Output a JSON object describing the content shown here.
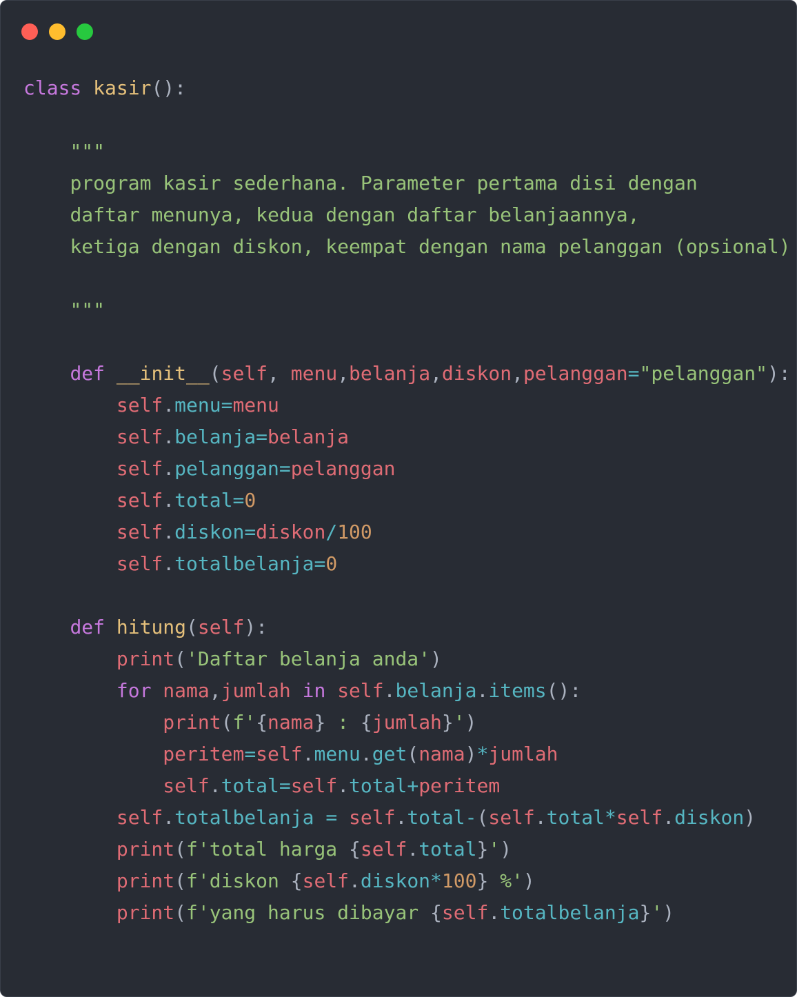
{
  "window": {
    "controls": [
      {
        "name": "close",
        "color": "#ff5f56"
      },
      {
        "name": "minimize",
        "color": "#ffbd2e"
      },
      {
        "name": "maximize",
        "color": "#27c93f"
      }
    ],
    "background": "#282c34"
  },
  "code_lines": [
    [
      [
        "kw",
        "class"
      ],
      [
        "pun",
        " "
      ],
      [
        "cls",
        "kasir"
      ],
      [
        "pun",
        "():"
      ]
    ],
    [],
    [
      [
        "pun",
        "    "
      ],
      [
        "doc",
        "\"\"\""
      ]
    ],
    [
      [
        "pun",
        "    "
      ],
      [
        "doc",
        "program kasir sederhana. Parameter pertama disi dengan"
      ]
    ],
    [
      [
        "pun",
        "    "
      ],
      [
        "doc",
        "daftar menunya, kedua dengan daftar belanjaannya,"
      ]
    ],
    [
      [
        "pun",
        "    "
      ],
      [
        "doc",
        "ketiga dengan diskon, keempat dengan nama pelanggan (opsional)"
      ]
    ],
    [],
    [
      [
        "pun",
        "    "
      ],
      [
        "doc",
        "\"\"\""
      ]
    ],
    [],
    [
      [
        "pun",
        "    "
      ],
      [
        "kw",
        "def"
      ],
      [
        "pun",
        " "
      ],
      [
        "fn",
        "__init__"
      ],
      [
        "pun",
        "("
      ],
      [
        "self",
        "self"
      ],
      [
        "pun",
        ", "
      ],
      [
        "var",
        "menu"
      ],
      [
        "pun",
        ","
      ],
      [
        "var",
        "belanja"
      ],
      [
        "pun",
        ","
      ],
      [
        "var",
        "diskon"
      ],
      [
        "pun",
        ","
      ],
      [
        "var",
        "pelanggan"
      ],
      [
        "op",
        "="
      ],
      [
        "str",
        "\"pelanggan\""
      ],
      [
        "pun",
        "):"
      ]
    ],
    [
      [
        "pun",
        "        "
      ],
      [
        "self",
        "self"
      ],
      [
        "pun",
        "."
      ],
      [
        "attr",
        "menu"
      ],
      [
        "op",
        "="
      ],
      [
        "var",
        "menu"
      ]
    ],
    [
      [
        "pun",
        "        "
      ],
      [
        "self",
        "self"
      ],
      [
        "pun",
        "."
      ],
      [
        "attr",
        "belanja"
      ],
      [
        "op",
        "="
      ],
      [
        "var",
        "belanja"
      ]
    ],
    [
      [
        "pun",
        "        "
      ],
      [
        "self",
        "self"
      ],
      [
        "pun",
        "."
      ],
      [
        "attr",
        "pelanggan"
      ],
      [
        "op",
        "="
      ],
      [
        "var",
        "pelanggan"
      ]
    ],
    [
      [
        "pun",
        "        "
      ],
      [
        "self",
        "self"
      ],
      [
        "pun",
        "."
      ],
      [
        "attr",
        "total"
      ],
      [
        "op",
        "="
      ],
      [
        "num",
        "0"
      ]
    ],
    [
      [
        "pun",
        "        "
      ],
      [
        "self",
        "self"
      ],
      [
        "pun",
        "."
      ],
      [
        "attr",
        "diskon"
      ],
      [
        "op",
        "="
      ],
      [
        "var",
        "diskon"
      ],
      [
        "op",
        "/"
      ],
      [
        "num",
        "100"
      ]
    ],
    [
      [
        "pun",
        "        "
      ],
      [
        "self",
        "self"
      ],
      [
        "pun",
        "."
      ],
      [
        "attr",
        "totalbelanja"
      ],
      [
        "op",
        "="
      ],
      [
        "num",
        "0"
      ]
    ],
    [],
    [
      [
        "pun",
        "    "
      ],
      [
        "kw",
        "def"
      ],
      [
        "pun",
        " "
      ],
      [
        "fn",
        "hitung"
      ],
      [
        "pun",
        "("
      ],
      [
        "self",
        "self"
      ],
      [
        "pun",
        "):"
      ]
    ],
    [
      [
        "pun",
        "        "
      ],
      [
        "builtin",
        "print"
      ],
      [
        "pun",
        "("
      ],
      [
        "str",
        "'Daftar belanja anda'"
      ],
      [
        "pun",
        ")"
      ]
    ],
    [
      [
        "pun",
        "        "
      ],
      [
        "kw",
        "for"
      ],
      [
        "pun",
        " "
      ],
      [
        "var",
        "nama"
      ],
      [
        "pun",
        ","
      ],
      [
        "var",
        "jumlah"
      ],
      [
        "pun",
        " "
      ],
      [
        "kw",
        "in"
      ],
      [
        "pun",
        " "
      ],
      [
        "self",
        "self"
      ],
      [
        "pun",
        "."
      ],
      [
        "attr",
        "belanja"
      ],
      [
        "pun",
        "."
      ],
      [
        "method",
        "items"
      ],
      [
        "pun",
        "():"
      ]
    ],
    [
      [
        "pun",
        "            "
      ],
      [
        "builtin",
        "print"
      ],
      [
        "pun",
        "("
      ],
      [
        "str",
        "f'"
      ],
      [
        "pun",
        "{"
      ],
      [
        "var",
        "nama"
      ],
      [
        "pun",
        "}"
      ],
      [
        "str",
        " : "
      ],
      [
        "pun",
        "{"
      ],
      [
        "var",
        "jumlah"
      ],
      [
        "pun",
        "}"
      ],
      [
        "str",
        "'"
      ],
      [
        "pun",
        ")"
      ]
    ],
    [
      [
        "pun",
        "            "
      ],
      [
        "var",
        "peritem"
      ],
      [
        "op",
        "="
      ],
      [
        "self",
        "self"
      ],
      [
        "pun",
        "."
      ],
      [
        "attr",
        "menu"
      ],
      [
        "pun",
        "."
      ],
      [
        "method",
        "get"
      ],
      [
        "pun",
        "("
      ],
      [
        "var",
        "nama"
      ],
      [
        "pun",
        ")"
      ],
      [
        "op",
        "*"
      ],
      [
        "var",
        "jumlah"
      ]
    ],
    [
      [
        "pun",
        "            "
      ],
      [
        "self",
        "self"
      ],
      [
        "pun",
        "."
      ],
      [
        "attr",
        "total"
      ],
      [
        "op",
        "="
      ],
      [
        "self",
        "self"
      ],
      [
        "pun",
        "."
      ],
      [
        "attr",
        "total"
      ],
      [
        "op",
        "+"
      ],
      [
        "var",
        "peritem"
      ]
    ],
    [
      [
        "pun",
        "        "
      ],
      [
        "self",
        "self"
      ],
      [
        "pun",
        "."
      ],
      [
        "attr",
        "totalbelanja"
      ],
      [
        "pun",
        " "
      ],
      [
        "op",
        "="
      ],
      [
        "pun",
        " "
      ],
      [
        "self",
        "self"
      ],
      [
        "pun",
        "."
      ],
      [
        "attr",
        "total"
      ],
      [
        "op",
        "-"
      ],
      [
        "pun",
        "("
      ],
      [
        "self",
        "self"
      ],
      [
        "pun",
        "."
      ],
      [
        "attr",
        "total"
      ],
      [
        "op",
        "*"
      ],
      [
        "self",
        "self"
      ],
      [
        "pun",
        "."
      ],
      [
        "attr",
        "diskon"
      ],
      [
        "pun",
        ")"
      ]
    ],
    [
      [
        "pun",
        "        "
      ],
      [
        "builtin",
        "print"
      ],
      [
        "pun",
        "("
      ],
      [
        "str",
        "f'total harga "
      ],
      [
        "pun",
        "{"
      ],
      [
        "self",
        "self"
      ],
      [
        "pun",
        "."
      ],
      [
        "attr",
        "total"
      ],
      [
        "pun",
        "}"
      ],
      [
        "str",
        "'"
      ],
      [
        "pun",
        ")"
      ]
    ],
    [
      [
        "pun",
        "        "
      ],
      [
        "builtin",
        "print"
      ],
      [
        "pun",
        "("
      ],
      [
        "str",
        "f'diskon "
      ],
      [
        "pun",
        "{"
      ],
      [
        "self",
        "self"
      ],
      [
        "pun",
        "."
      ],
      [
        "attr",
        "diskon"
      ],
      [
        "op",
        "*"
      ],
      [
        "num",
        "100"
      ],
      [
        "pun",
        "}"
      ],
      [
        "str",
        " %'"
      ],
      [
        "pun",
        ")"
      ]
    ],
    [
      [
        "pun",
        "        "
      ],
      [
        "builtin",
        "print"
      ],
      [
        "pun",
        "("
      ],
      [
        "str",
        "f'yang harus dibayar "
      ],
      [
        "pun",
        "{"
      ],
      [
        "self",
        "self"
      ],
      [
        "pun",
        "."
      ],
      [
        "attr",
        "totalbelanja"
      ],
      [
        "pun",
        "}"
      ],
      [
        "str",
        "'"
      ],
      [
        "pun",
        ")"
      ]
    ]
  ]
}
